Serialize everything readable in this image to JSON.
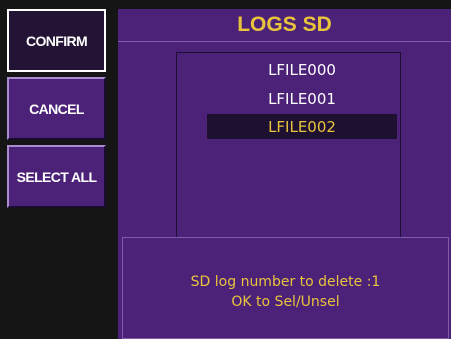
{
  "sidebar": {
    "confirm_label": "CONFIRM",
    "cancel_label": "CANCEL",
    "select_all_label": "SELECT ALL"
  },
  "panel": {
    "title": "LOGS SD",
    "files": [
      "LFILE000",
      "LFILE001",
      "LFILE002"
    ],
    "selected_file": "LFILE002",
    "message": {
      "line1": "SD log number to delete :1",
      "line2": "OK to Sel/Unsel"
    }
  },
  "colors": {
    "background": "#151515",
    "panel": "#4c2278",
    "accent_text": "#e8c43c",
    "selected_row": "#1e1030"
  }
}
